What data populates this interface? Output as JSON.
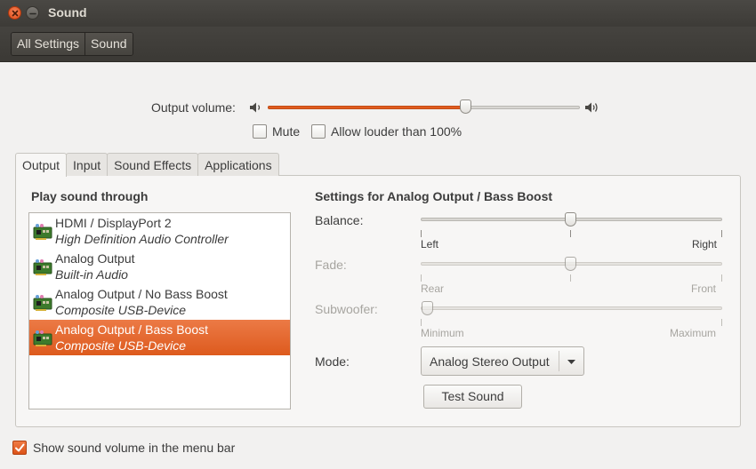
{
  "window": {
    "title": "Sound"
  },
  "breadcrumbs": [
    {
      "label": "All Settings"
    },
    {
      "label": "Sound"
    }
  ],
  "output_volume": {
    "label": "Output volume:",
    "value_fraction": 0.59
  },
  "options": {
    "mute": {
      "label": "Mute",
      "checked": false
    },
    "allow_louder": {
      "label": "Allow louder than 100%",
      "checked": false
    }
  },
  "tabs": [
    {
      "label": "Output",
      "active": true
    },
    {
      "label": "Input",
      "active": false
    },
    {
      "label": "Sound Effects",
      "active": false
    },
    {
      "label": "Applications",
      "active": false
    }
  ],
  "play_through": {
    "heading": "Play sound through",
    "devices": [
      {
        "name": "HDMI / DisplayPort 2",
        "sub": "High Definition Audio Controller",
        "selected": false
      },
      {
        "name": "Analog Output",
        "sub": "Built-in Audio",
        "selected": false
      },
      {
        "name": "Analog Output / No Bass Boost",
        "sub": "Composite USB-Device",
        "selected": false
      },
      {
        "name": "Analog Output / Bass Boost",
        "sub": "Composite USB-Device",
        "selected": true
      }
    ]
  },
  "settings": {
    "heading": "Settings for Analog Output / Bass Boost",
    "balance": {
      "label": "Balance:",
      "left": "Left",
      "right": "Right",
      "value_fraction": 0.5,
      "enabled": true
    },
    "fade": {
      "label": "Fade:",
      "left": "Rear",
      "right": "Front",
      "value_fraction": 0.5,
      "enabled": false
    },
    "subwoofer": {
      "label": "Subwoofer:",
      "left": "Minimum",
      "right": "Maximum",
      "value_fraction": 0.0,
      "enabled": false
    },
    "mode": {
      "label": "Mode:",
      "value": "Analog Stereo Output"
    },
    "test_sound": {
      "label": "Test Sound"
    }
  },
  "menu_bar_option": {
    "label": "Show sound volume in the menu bar",
    "checked": true
  },
  "colors": {
    "accent": "#dd5a1d",
    "titlebar": "#3d3b37",
    "background": "#f2f1f0"
  }
}
